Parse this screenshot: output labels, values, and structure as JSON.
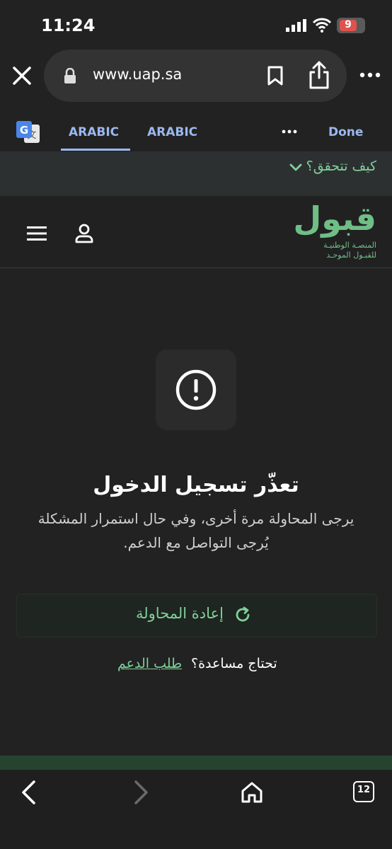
{
  "status": {
    "time": "11:24",
    "battery": "9"
  },
  "browser": {
    "url": "www.uap.sa",
    "icons": [
      "close-icon",
      "lock-icon",
      "bookmark-icon",
      "share-icon",
      "more-icon"
    ]
  },
  "translate": {
    "tabs": [
      "ARABIC",
      "ARABIC"
    ],
    "done": "Done"
  },
  "verify": {
    "text": "كيف تتحقق؟"
  },
  "site": {
    "logo": "قبول",
    "logo_sub1": "المنصـة الوطنيـة",
    "logo_sub2": "للقبـول الموحـد"
  },
  "error": {
    "title": "تعذّر تسجيل الدخول",
    "body": "يرجى المحاولة مرة أخرى، وفي حال استمرار المشكلة يُرجى التواصل مع الدعم."
  },
  "retry": {
    "label": "إعادة المحاولة"
  },
  "help": {
    "question": "تحتاج مساعدة؟",
    "link": "طلب الدعم"
  },
  "toolbar": {
    "tabs_count": "12"
  },
  "colors": {
    "accent_green": "#7fd19b",
    "link_blue": "#9bb8ef",
    "background": "#222222"
  }
}
